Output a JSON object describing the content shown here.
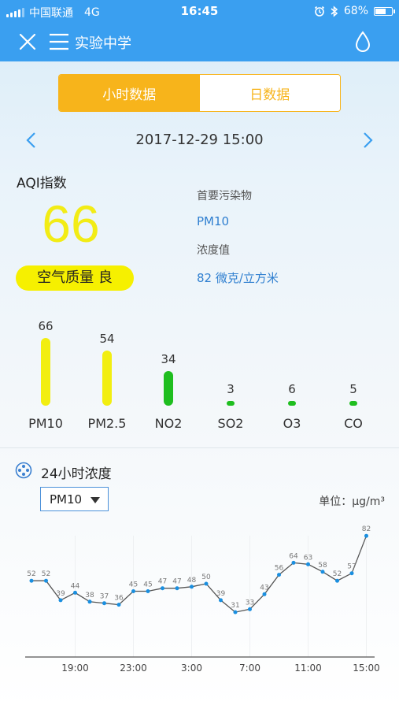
{
  "status": {
    "carrier": "中国联通",
    "network": "4G",
    "time": "16:45",
    "battery": "68%",
    "battery_level": 0.68,
    "icons": [
      "alarm-icon",
      "bluetooth-icon",
      "battery-icon"
    ]
  },
  "nav": {
    "title": "实验中学",
    "icons": [
      "close-icon",
      "menu-icon",
      "drop-icon"
    ]
  },
  "tabs": [
    {
      "label": "小时数据",
      "active": true
    },
    {
      "label": "日数据",
      "active": false
    }
  ],
  "date": "2017-12-29 15:00",
  "aqi": {
    "label": "AQI指数",
    "value": "66",
    "quality": "空气质量 良",
    "primary_label": "首要污染物",
    "primary_value": "PM10",
    "conc_label": "浓度值",
    "conc_value": "82 微克/立方米"
  },
  "pollutants": [
    {
      "name": "PM10",
      "value": 66,
      "value_text": "66",
      "color": "#f2ee10"
    },
    {
      "name": "PM2.5",
      "value": 54,
      "value_text": "54",
      "color": "#f2ee10"
    },
    {
      "name": "NO2",
      "value": 34,
      "value_text": "34",
      "color": "#1fbe1f"
    },
    {
      "name": "SO2",
      "value": 3,
      "value_text": "3",
      "color": "#1fbe1f"
    },
    {
      "name": "O3",
      "value": 6,
      "value_text": "6",
      "color": "#1fbe1f"
    },
    {
      "name": "CO",
      "value": 5,
      "value_text": "5",
      "color": "#1fbe1f"
    }
  ],
  "concentration": {
    "title": "24小时浓度",
    "selected": "PM10",
    "unit": "单位：μg/m³"
  },
  "chart_data": {
    "type": "line",
    "series": [
      {
        "values": [
          52,
          52,
          39,
          44,
          38,
          37,
          36,
          45,
          45,
          47,
          47,
          48,
          50,
          39,
          31,
          33,
          43,
          56,
          64,
          63,
          58,
          52,
          57,
          82
        ]
      }
    ],
    "x_ticks": [
      "19:00",
      "23:00",
      "3:00",
      "7:00",
      "11:00",
      "15:00"
    ],
    "x_tick_index": [
      3,
      7,
      11,
      15,
      19,
      23
    ],
    "color": "#1a8fe0"
  }
}
